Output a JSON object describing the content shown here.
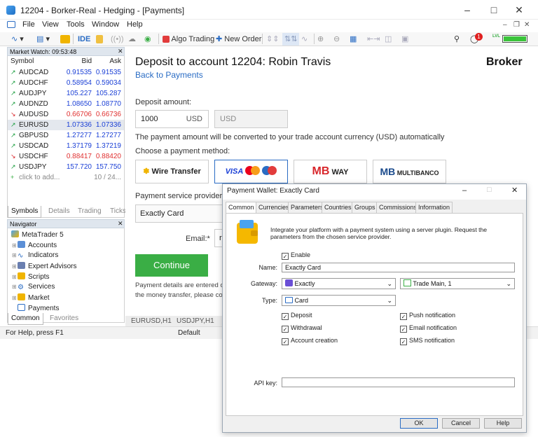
{
  "window": {
    "title": "12204 - Borker-Real - Hedging - [Payments]"
  },
  "menu": [
    "File",
    "View",
    "Tools",
    "Window",
    "Help"
  ],
  "toolbar": {
    "ide": "IDE",
    "algo": "Algo Trading",
    "new_order": "New Order",
    "badge_count": "1",
    "lvl": "LVL"
  },
  "market_watch": {
    "title": "Market Watch: 09:53:48",
    "headers": {
      "symbol": "Symbol",
      "bid": "Bid",
      "ask": "Ask"
    },
    "rows": [
      {
        "symbol": "AUDCAD",
        "bid": "0.91535",
        "ask": "0.91535",
        "dir": "up"
      },
      {
        "symbol": "AUDCHF",
        "bid": "0.58954",
        "ask": "0.59034",
        "dir": "up"
      },
      {
        "symbol": "AUDJPY",
        "bid": "105.227",
        "ask": "105.287",
        "dir": "up"
      },
      {
        "symbol": "AUDNZD",
        "bid": "1.08650",
        "ask": "1.08770",
        "dir": "up"
      },
      {
        "symbol": "AUDUSD",
        "bid": "0.66706",
        "ask": "0.66736",
        "dir": "down"
      },
      {
        "symbol": "EURUSD",
        "bid": "1.07336",
        "ask": "1.07336",
        "dir": "up"
      },
      {
        "symbol": "GBPUSD",
        "bid": "1.27277",
        "ask": "1.27277",
        "dir": "up"
      },
      {
        "symbol": "USDCAD",
        "bid": "1.37179",
        "ask": "1.37219",
        "dir": "up"
      },
      {
        "symbol": "USDCHF",
        "bid": "0.88417",
        "ask": "0.88420",
        "dir": "down"
      },
      {
        "symbol": "USDJPY",
        "bid": "157.720",
        "ask": "157.750",
        "dir": "up"
      }
    ],
    "add_text": "click to add...",
    "count": "10 / 24...",
    "tabs": [
      "Symbols",
      "Details",
      "Trading",
      "Ticks"
    ]
  },
  "navigator": {
    "title": "Navigator",
    "items": [
      "MetaTrader 5",
      "Accounts",
      "Indicators",
      "Expert Advisors",
      "Scripts",
      "Services",
      "Market",
      "Payments"
    ],
    "tabs": [
      "Common",
      "Favorites"
    ]
  },
  "status": {
    "help": "For Help, press F1",
    "profile": "Default"
  },
  "chart_tabs": [
    "EURUSD,H1",
    "USDJPY,H1"
  ],
  "deposit": {
    "title": "Deposit to account 12204: Robin Travis",
    "back": "Back to Payments",
    "broker": "Broker",
    "amount_label": "Deposit amount:",
    "amount_value": "1000",
    "amount_currency": "USD",
    "converted_currency": "USD",
    "convert_note": "The payment amount will be converted to your trade account currency (USD) automatically",
    "method_label": "Choose a payment method:",
    "methods": {
      "wire": "Wire Transfer",
      "visa": "VISA",
      "mbway_mb": "MB",
      "mbway_way": "WAY",
      "multibanco_mb": "MB",
      "multibanco": "MULTIBANCO"
    },
    "provider_label": "Payment service provider:",
    "provider_value": "Exactly Card",
    "email_label": "Email:*",
    "email_value": "r",
    "continue": "Continue",
    "details_note_1": "Payment details are entered on",
    "details_note_2": "the money transfer, please cont"
  },
  "dialog": {
    "title": "Payment Wallet: Exactly Card",
    "tabs": [
      "Common",
      "Currencies",
      "Parameters",
      "Countries",
      "Groups",
      "Commissions",
      "Information"
    ],
    "intro": "Integrate your platform with a payment system using a server plugin. Request the parameters from the chosen service provider.",
    "enable": "Enable",
    "name_label": "Name:",
    "name_value": "Exactly Card",
    "gateway_label": "Gateway:",
    "gateway_value": "Exactly",
    "server_value": "Trade Main, 1",
    "type_label": "Type:",
    "type_value": "Card",
    "checks": {
      "deposit": "Deposit",
      "withdrawal": "Withdrawal",
      "account_creation": "Account creation",
      "push": "Push notification",
      "email": "Email notification",
      "sms": "SMS notification"
    },
    "api_label": "API key:",
    "api_value": "",
    "buttons": {
      "ok": "OK",
      "cancel": "Cancel",
      "help": "Help"
    }
  }
}
